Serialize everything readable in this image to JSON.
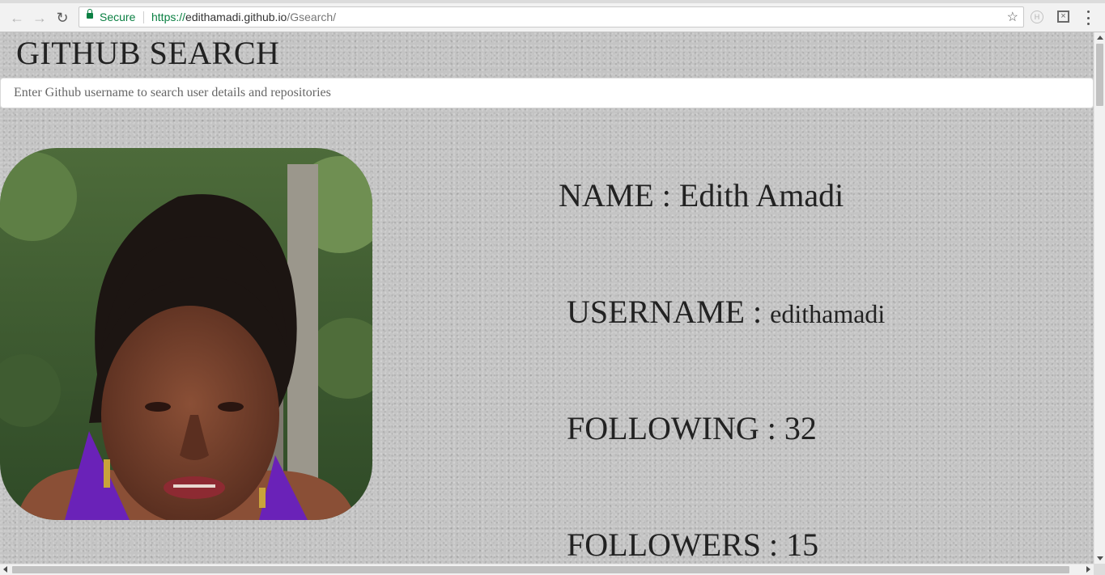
{
  "browser": {
    "security_label": "Secure",
    "url_scheme": "https://",
    "url_host": "edithamadi.github.io",
    "url_path": "/Gsearch/",
    "icons": [
      "back-arrow-icon",
      "forward-arrow-icon",
      "reload-icon",
      "lock-icon",
      "bookmark-star-icon",
      "extension-h-icon",
      "extension-x-icon",
      "menu-dots-icon"
    ],
    "secure_color": "#0b8043"
  },
  "page": {
    "title": "GITHUB SEARCH",
    "search": {
      "placeholder": "Enter Github username to search user details and repositories",
      "value": ""
    },
    "profile": {
      "name_label": "NAME : Edith Amadi",
      "username_label": "USERNAME : ",
      "username_value": "edithamadi",
      "following_label": "FOLLOWING : 32",
      "followers_label": "FOLLOWERS : 15"
    },
    "colors": {
      "background": "#c4c4c4",
      "text": "#222222"
    }
  }
}
